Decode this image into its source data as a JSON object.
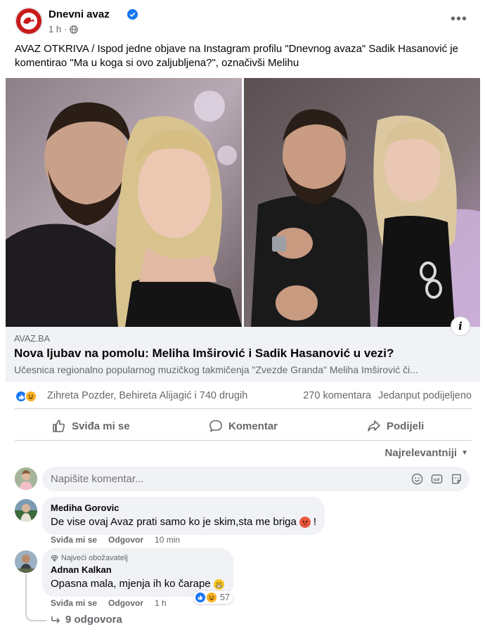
{
  "post": {
    "page_name": "Dnevni avaz",
    "time": "1 h",
    "privacy_icon": "globe-icon",
    "text": "AVAZ OTKRIVA / Ispod jedne objave na Instagram profilu \"Dnevnog avaza\" Sadik Hasanović je komentirao \"Ma u koga si ovo zaljubljena?\", označivši Melihu"
  },
  "link": {
    "domain": "AVAZ.BA",
    "title": "Nova ljubav na pomolu: Meliha Imširović i Sadik Hasanović u vezi?",
    "description": "Učesnica regionalno popularnog muzičkog takmičenja \"Zvezde Granda\" Meliha Imširović či...",
    "info_icon": "i"
  },
  "stats": {
    "reactors": "Zihreta Pozder, Behireta Alijagić i 740 drugih",
    "comments": "270 komentara",
    "shares": "Jedanput podijeljeno"
  },
  "actions": {
    "like": "Sviđa mi se",
    "comment": "Komentar",
    "share": "Podijeli"
  },
  "sort": {
    "label": "Najrelevantniji"
  },
  "composer": {
    "placeholder": "Napišite komentar..."
  },
  "comments": [
    {
      "author": "Mediha Gorovic",
      "text": "De vise ovaj Avaz prati samo ko je skim,sta me briga",
      "text_suffix": "!",
      "like": "Sviđa mi se",
      "reply": "Odgovor",
      "time": "10 min"
    },
    {
      "badge": "Najveći obožavatelj",
      "author": "Adnan Kalkan",
      "text": "Opasna mala, mjenja ih ko čarape",
      "like": "Sviđa mi se",
      "reply": "Odgovor",
      "time": "1 h",
      "reaction_count": "57"
    }
  ],
  "replies": {
    "label": "9 odgovora"
  },
  "colors": {
    "brand": "#1877f2",
    "secondary_text": "#65676b",
    "link_bg": "#f0f2f5",
    "avaz_red": "#c91a1a"
  }
}
